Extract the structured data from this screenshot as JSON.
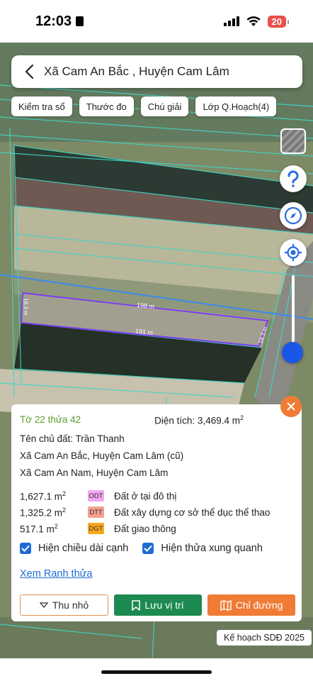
{
  "status_bar": {
    "time": "12:03",
    "battery": "20",
    "battery_color": "#e8514a"
  },
  "search": {
    "location_text": "Xã Cam An Bắc , Huyện Cam Lâm",
    "back_icon": "chevron-left-icon"
  },
  "chips": [
    {
      "label": "Kiểm tra sổ"
    },
    {
      "label": "Thước đo"
    },
    {
      "label": "Chú giải"
    },
    {
      "label": "Lớp Q.Hoạch(4)"
    }
  ],
  "map": {
    "edge_label_top": "198 m",
    "edge_label_bottom": "191 m",
    "edge_label_left": "18.3 m",
    "edge_label_right": "18.3 m",
    "parcel_outline_color": "#7b3cf0",
    "boundary_color": "#3fd7c8"
  },
  "panel": {
    "parcel_id": "Tờ 22 thửa 42",
    "area_label": "Diện tích: 3,469.4 m",
    "area_sup": "2",
    "owner": "Tên chủ đất: Trần Thanh",
    "address_old": "Xã Cam An Bắc, Huyện Cam Lâm (cũ)",
    "address_new": "Xã Cam An Nam, Huyện Cam Lâm",
    "land_use": [
      {
        "area": "1,627.1 m",
        "code": "ODT",
        "color": "#f0a8f0",
        "desc": "Đất ở tại đô thị"
      },
      {
        "area": "1,325.2 m",
        "code": "DTT",
        "color": "#f4a090",
        "desc": "Đất xây dựng cơ sở thể dục thể thao"
      },
      {
        "area": "517.1 m",
        "code": "DGT",
        "color": "#f6a81f",
        "desc": "Đất giao thông"
      }
    ],
    "sup": "2",
    "check_edge_length": "Hiện chiều dài cạnh",
    "check_neighbors": "Hiện thửa xung quanh",
    "link_boundary": "Xem Ranh thửa",
    "btn_shrink": "Thu nhỏ",
    "btn_save": "Lưu vị trí",
    "btn_route": "Chỉ đường"
  },
  "plan_badge": "Kế hoạch SDĐ 2025"
}
